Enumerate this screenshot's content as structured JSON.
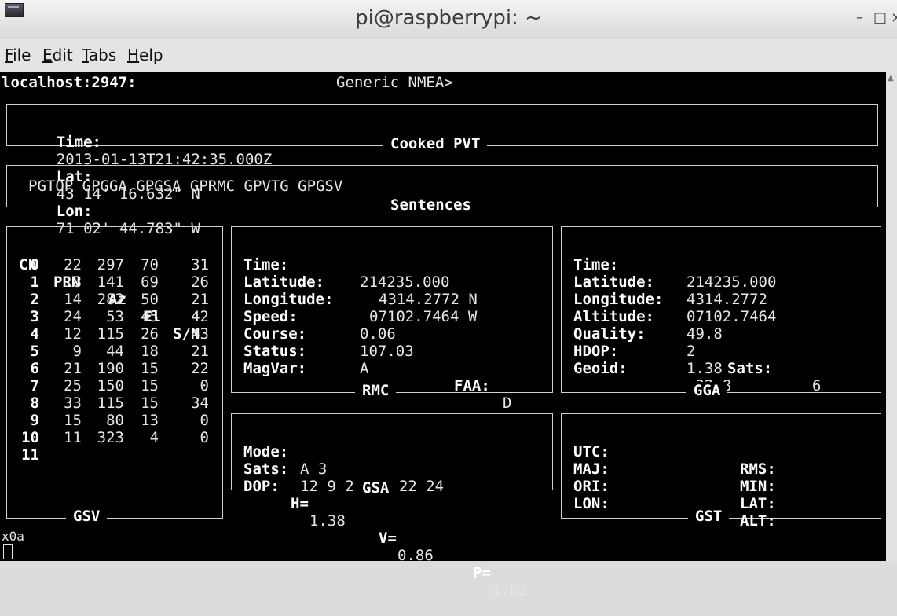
{
  "window": {
    "title": "pi@raspberrypi: ~",
    "minimize": "–",
    "maximize": "□",
    "close": "×"
  },
  "menu": [
    {
      "first": "F",
      "rest": "ile"
    },
    {
      "first": "E",
      "rest": "dit"
    },
    {
      "first": "T",
      "rest": "abs"
    },
    {
      "first": "H",
      "rest": "elp"
    }
  ],
  "header": {
    "host": "localhost:2947:",
    "device": "Generic NMEA>"
  },
  "cooked": {
    "caption": "Cooked PVT",
    "time_label": "Time:",
    "time_value": "2013-01-13T21:42:35.000Z",
    "lat_label": "Lat:",
    "lat_value": "43 14' 16.632\" N",
    "lon_label": "Lon:",
    "lon_value": "71 02' 44.783\" W"
  },
  "sentences": {
    "caption": "Sentences",
    "list": "PGTOP GPGGA GPGSA GPRMC GPVTG GPGSV"
  },
  "gsv": {
    "caption": "GSV",
    "headers": [
      "Ch",
      "PRN",
      "Az",
      "El",
      "S/N"
    ],
    "rows": [
      [
        "0",
        "22",
        "297",
        "70",
        "31"
      ],
      [
        "1",
        "18",
        "141",
        "69",
        "26"
      ],
      [
        "2",
        "14",
        "282",
        "50",
        "21"
      ],
      [
        "3",
        "24",
        "53",
        "45",
        "42"
      ],
      [
        "4",
        "12",
        "115",
        "26",
        "43"
      ],
      [
        "5",
        "9",
        "44",
        "18",
        "21"
      ],
      [
        "6",
        "21",
        "190",
        "15",
        "22"
      ],
      [
        "7",
        "25",
        "150",
        "15",
        "0"
      ],
      [
        "8",
        "33",
        "115",
        "15",
        "34"
      ],
      [
        "9",
        "15",
        "80",
        "13",
        "0"
      ],
      [
        "10",
        "11",
        "323",
        "4",
        "0"
      ],
      [
        "11",
        "",
        "",
        "",
        ""
      ]
    ]
  },
  "rmc": {
    "caption": "RMC",
    "time_label": "Time:",
    "time": "214235.000",
    "lat_label": "Latitude:",
    "lat": "4314.2772 N",
    "lon_label": "Longitude:",
    "lon": "07102.7464 W",
    "speed_label": "Speed:",
    "speed": "0.06",
    "course_label": "Course:",
    "course": "107.03",
    "status_label": "Status:",
    "status": "A",
    "faa_label": "FAA:",
    "faa": "D",
    "magvar_label": "MagVar:",
    "magvar": ""
  },
  "gga": {
    "caption": "GGA",
    "time_label": "Time:",
    "time": "214235.000",
    "lat_label": "Latitude:",
    "lat": "4314.2772",
    "lon_label": "Longitude:",
    "lon": "07102.7464",
    "alt_label": "Altitude:",
    "alt": "49.8",
    "quality_label": "Quality:",
    "quality": "2",
    "sats_label": "Sats:",
    "sats": "6",
    "hdop_label": "HDOP:",
    "hdop": "1.38",
    "geoid_label": "Geoid:",
    "geoid": "-32.8"
  },
  "gsa": {
    "caption": "GSA",
    "mode_label": "Mode:",
    "mode": "A 3",
    "sats_label": "Sats:",
    "sats": "12 9 21 18 22 24",
    "dop_label": "DOP:",
    "h_label": "H=",
    "h": "1.38",
    "v_label": "V=",
    "v": "0.86",
    "p_label": "P=",
    "p": "1.62"
  },
  "gst": {
    "caption": "GST",
    "utc": "UTC:",
    "rms": "RMS:",
    "maj": "MAJ:",
    "min": "MIN:",
    "ori": "ORI:",
    "lat": "LAT:",
    "lon": "LON:",
    "alt": "ALT:"
  },
  "footer": {
    "line": "x0a"
  }
}
